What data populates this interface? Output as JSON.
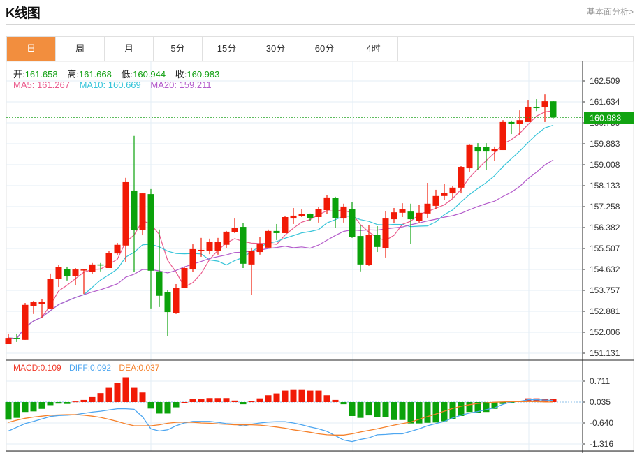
{
  "header": {
    "title": "K线图",
    "link": "基本面分析>"
  },
  "tabs": [
    {
      "label": "日",
      "active": true
    },
    {
      "label": "周"
    },
    {
      "label": "月"
    },
    {
      "label": "5分"
    },
    {
      "label": "15分"
    },
    {
      "label": "30分"
    },
    {
      "label": "60分"
    },
    {
      "label": "4时"
    }
  ],
  "ohlc_info": {
    "open_label": "开:",
    "open": "161.658",
    "high_label": "高:",
    "high": "161.668",
    "low_label": "低:",
    "low": "160.944",
    "close_label": "收:",
    "close": "160.983"
  },
  "ma_info": {
    "ma5": "MA5: 161.267",
    "ma10": "MA10: 160.669",
    "ma20": "MA20: 159.211"
  },
  "macd_info": {
    "macd": "MACD:0.109",
    "diff": "DIFF:0.092",
    "dea": "DEA:0.037"
  },
  "current_price": "160.983",
  "colors": {
    "up": "#f11a06",
    "down": "#0ba20b",
    "ma5": "#ea5a8c",
    "ma10": "#36c4d9",
    "ma20": "#b45ccb",
    "diff": "#4da6f0",
    "dea": "#f5802a",
    "accent": "#f28e3e"
  },
  "chart_data": [
    {
      "type": "candlestick",
      "title": "K线图",
      "y_ticks": [
        "162.509",
        "161.634",
        "160.759",
        "159.883",
        "159.008",
        "158.133",
        "157.258",
        "156.382",
        "155.507",
        "154.632",
        "153.757",
        "152.881",
        "152.006",
        "151.131"
      ],
      "ylim": [
        151.131,
        162.509
      ],
      "ohlc": [
        [
          151.51,
          151.95,
          151.51,
          151.77
        ],
        [
          151.77,
          151.95,
          151.6,
          151.72
        ],
        [
          151.69,
          153.23,
          151.69,
          153.15
        ],
        [
          153.09,
          153.32,
          152.77,
          153.26
        ],
        [
          153.2,
          153.38,
          152.62,
          153.29
        ],
        [
          153.0,
          154.46,
          152.97,
          154.25
        ],
        [
          154.23,
          154.81,
          153.9,
          154.72
        ],
        [
          154.66,
          154.75,
          154.17,
          154.34
        ],
        [
          154.34,
          154.69,
          153.96,
          154.63
        ],
        [
          154.6,
          154.66,
          153.61,
          154.63
        ],
        [
          154.52,
          154.9,
          154.43,
          154.84
        ],
        [
          154.84,
          154.9,
          154.55,
          154.81
        ],
        [
          154.69,
          155.39,
          154.69,
          155.33
        ],
        [
          155.3,
          155.74,
          155.22,
          155.66
        ],
        [
          155.63,
          158.46,
          154.95,
          158.28
        ],
        [
          157.93,
          160.21,
          154.52,
          156.27
        ],
        [
          156.27,
          157.84,
          156.06,
          157.81
        ],
        [
          157.78,
          157.99,
          153.0,
          154.58
        ],
        [
          154.55,
          156.3,
          153.06,
          153.53
        ],
        [
          153.67,
          153.76,
          151.86,
          152.85
        ],
        [
          152.8,
          154.02,
          152.77,
          153.85
        ],
        [
          153.85,
          154.75,
          153.85,
          154.69
        ],
        [
          154.66,
          155.68,
          154.52,
          155.48
        ],
        [
          155.42,
          155.95,
          155.16,
          155.45
        ],
        [
          155.42,
          155.92,
          155.27,
          155.77
        ],
        [
          155.4,
          155.95,
          155.25,
          155.78
        ],
        [
          155.66,
          156.24,
          155.51,
          156.21
        ],
        [
          156.18,
          156.76,
          156.15,
          156.38
        ],
        [
          156.41,
          156.56,
          154.69,
          154.87
        ],
        [
          154.84,
          155.54,
          153.58,
          155.42
        ],
        [
          155.36,
          155.98,
          155.25,
          155.71
        ],
        [
          155.54,
          156.3,
          155.54,
          156.24
        ],
        [
          156.24,
          156.53,
          155.86,
          156.15
        ],
        [
          156.15,
          156.85,
          156.15,
          156.82
        ],
        [
          156.76,
          157.2,
          156.53,
          156.88
        ],
        [
          156.85,
          157.14,
          156.82,
          156.94
        ],
        [
          156.94,
          156.97,
          156.67,
          156.79
        ],
        [
          156.82,
          157.23,
          156.59,
          157.17
        ],
        [
          157.11,
          157.73,
          156.94,
          157.64
        ],
        [
          157.61,
          157.67,
          156.38,
          156.79
        ],
        [
          156.76,
          157.38,
          156.59,
          157.26
        ],
        [
          157.17,
          157.46,
          155.95,
          156.0
        ],
        [
          156.03,
          156.47,
          154.55,
          154.84
        ],
        [
          154.81,
          156.47,
          154.78,
          156.09
        ],
        [
          156.09,
          156.44,
          155.36,
          155.57
        ],
        [
          155.51,
          157.08,
          155.13,
          156.76
        ],
        [
          156.73,
          157.2,
          156.56,
          157.02
        ],
        [
          157.0,
          157.4,
          156.82,
          157.14
        ],
        [
          157.05,
          157.38,
          155.71,
          156.73
        ],
        [
          156.65,
          157.32,
          156.59,
          157.0
        ],
        [
          156.97,
          158.25,
          156.79,
          157.38
        ],
        [
          157.29,
          157.96,
          157.17,
          157.7
        ],
        [
          157.7,
          158.22,
          157.52,
          157.84
        ],
        [
          157.81,
          158.13,
          157.61,
          158.05
        ],
        [
          158.05,
          158.95,
          157.81,
          158.92
        ],
        [
          158.86,
          159.85,
          158.69,
          159.83
        ],
        [
          159.74,
          159.91,
          158.78,
          159.56
        ],
        [
          159.74,
          159.91,
          158.78,
          159.56
        ],
        [
          159.56,
          159.77,
          159.18,
          159.65
        ],
        [
          159.62,
          160.87,
          159.62,
          160.79
        ],
        [
          160.79,
          160.85,
          160.29,
          160.73
        ],
        [
          160.7,
          161.28,
          160.26,
          160.87
        ],
        [
          160.79,
          161.72,
          160.79,
          161.43
        ],
        [
          161.43,
          161.75,
          161.25,
          161.37
        ],
        [
          161.4,
          161.95,
          160.79,
          161.66
        ],
        [
          161.658,
          161.668,
          160.944,
          160.983
        ]
      ],
      "ma_periods": [
        5,
        10,
        20
      ]
    },
    {
      "type": "bar+line",
      "title": "MACD",
      "y_ticks": [
        "0.711",
        "0.035",
        "-0.640",
        "-1.316"
      ],
      "ylim": [
        -1.45,
        0.95
      ],
      "macd": [
        -0.57,
        -0.51,
        -0.32,
        -0.3,
        -0.22,
        -0.1,
        -0.05,
        -0.06,
        0.02,
        0.07,
        0.16,
        0.29,
        0.46,
        0.62,
        0.8,
        0.46,
        0.31,
        -0.21,
        -0.37,
        -0.37,
        -0.17,
        0.0,
        0.09,
        0.09,
        0.13,
        0.13,
        0.13,
        0.05,
        -0.07,
        0.03,
        0.12,
        0.22,
        0.28,
        0.37,
        0.39,
        0.39,
        0.37,
        0.37,
        0.22,
        0.07,
        -0.07,
        -0.45,
        -0.51,
        -0.43,
        -0.49,
        -0.49,
        -0.58,
        -0.58,
        -0.69,
        -0.69,
        -0.67,
        -0.66,
        -0.62,
        -0.55,
        -0.45,
        -0.32,
        -0.34,
        -0.32,
        -0.22,
        -0.06,
        -0.02,
        0.04,
        0.12,
        0.12,
        0.11,
        0.109
      ],
      "diff": [
        -0.9,
        -0.78,
        -0.66,
        -0.59,
        -0.51,
        -0.43,
        -0.4,
        -0.39,
        -0.37,
        -0.33,
        -0.29,
        -0.26,
        -0.22,
        -0.18,
        -0.18,
        -0.2,
        -0.44,
        -0.83,
        -0.9,
        -0.86,
        -0.73,
        -0.64,
        -0.59,
        -0.59,
        -0.59,
        -0.62,
        -0.66,
        -0.68,
        -0.74,
        -0.68,
        -0.64,
        -0.61,
        -0.6,
        -0.6,
        -0.64,
        -0.7,
        -0.77,
        -0.83,
        -0.91,
        -1.05,
        -1.19,
        -1.24,
        -1.17,
        -1.12,
        -1.02,
        -1.01,
        -0.99,
        -0.99,
        -0.91,
        -0.83,
        -0.73,
        -0.66,
        -0.59,
        -0.48,
        -0.39,
        -0.32,
        -0.27,
        -0.21,
        -0.15,
        -0.04,
        0.04,
        0.06,
        0.11,
        0.11,
        0.1,
        0.092
      ],
      "dea": [
        -0.62,
        -0.55,
        -0.49,
        -0.45,
        -0.42,
        -0.39,
        -0.38,
        -0.37,
        -0.37,
        -0.39,
        -0.42,
        -0.46,
        -0.52,
        -0.59,
        -0.67,
        -0.73,
        -0.73,
        -0.73,
        -0.7,
        -0.65,
        -0.62,
        -0.61,
        -0.62,
        -0.64,
        -0.65,
        -0.67,
        -0.68,
        -0.7,
        -0.7,
        -0.7,
        -0.71,
        -0.74,
        -0.77,
        -0.81,
        -0.86,
        -0.9,
        -0.94,
        -0.99,
        -1.02,
        -1.03,
        -1.03,
        -0.99,
        -0.93,
        -0.88,
        -0.83,
        -0.77,
        -0.71,
        -0.66,
        -0.61,
        -0.52,
        -0.43,
        -0.35,
        -0.26,
        -0.17,
        -0.1,
        -0.05,
        -0.01,
        0.01,
        0.03,
        0.04,
        0.05,
        0.05,
        0.05,
        0.05,
        0.04,
        0.037
      ]
    }
  ]
}
